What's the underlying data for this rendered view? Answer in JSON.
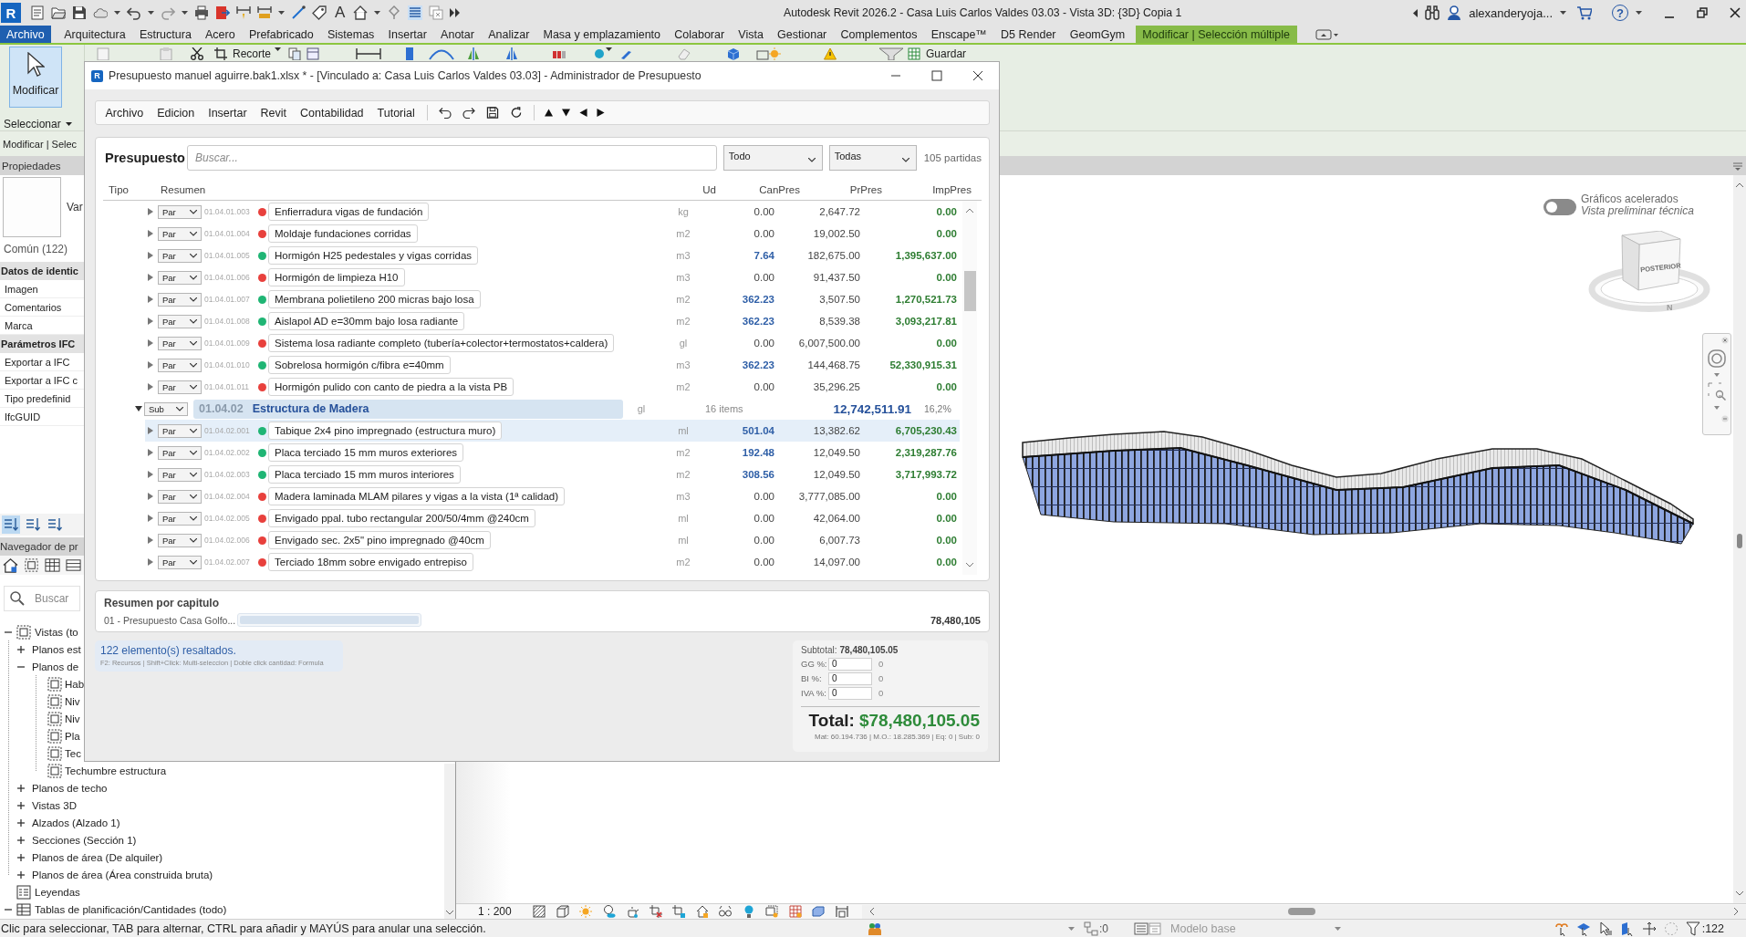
{
  "title_bar": {
    "logo_letter": "R",
    "text_tool_glyph": "A",
    "title": "Autodesk Revit 2026.2 - Casa Luis Carlos Valdes 03.03 - Vista 3D: {3D} Copia 1",
    "user": "alexanderyoja...",
    "help_glyph": "?"
  },
  "ribbon": {
    "tabs": [
      {
        "label": "Archivo",
        "kind": "file",
        "selected": false
      },
      {
        "label": "Arquitectura",
        "kind": "standard",
        "selected": false
      },
      {
        "label": "Estructura",
        "kind": "standard",
        "selected": false
      },
      {
        "label": "Acero",
        "kind": "standard",
        "selected": false
      },
      {
        "label": "Prefabricado",
        "kind": "standard",
        "selected": false
      },
      {
        "label": "Sistemas",
        "kind": "standard",
        "selected": false
      },
      {
        "label": "Insertar",
        "kind": "standard",
        "selected": false
      },
      {
        "label": "Anotar",
        "kind": "standard",
        "selected": false
      },
      {
        "label": "Analizar",
        "kind": "standard",
        "selected": false
      },
      {
        "label": "Masa y emplazamiento",
        "kind": "standard",
        "selected": false
      },
      {
        "label": "Colaborar",
        "kind": "standard",
        "selected": false
      },
      {
        "label": "Vista",
        "kind": "standard",
        "selected": false
      },
      {
        "label": "Gestionar",
        "kind": "standard",
        "selected": false
      },
      {
        "label": "Complementos",
        "kind": "standard",
        "selected": false
      },
      {
        "label": "Enscape™",
        "kind": "standard",
        "selected": false
      },
      {
        "label": "D5 Render",
        "kind": "standard",
        "selected": false
      },
      {
        "label": "GeomGym",
        "kind": "standard",
        "selected": false
      },
      {
        "label": "Modificar | Selección múltiple",
        "kind": "contextual",
        "selected": true
      }
    ],
    "modify_button": "Modificar",
    "select_menu": "Seleccionar",
    "crop_tool": "Recorte",
    "save_tool": "Guardar"
  },
  "options_bar": {
    "label": "Modificar | Selec"
  },
  "properties": {
    "title": "Propiedades",
    "type_name": "Var",
    "selection": "Común (122)",
    "groups": [
      {
        "name": "Datos de identic",
        "params": [
          "Imagen",
          "Comentarios",
          "Marca"
        ]
      },
      {
        "name": "Parámetros IFC",
        "params": [
          "Exportar a IFC",
          "Exportar a IFC c",
          "Tipo predefinid",
          "IfcGUID"
        ]
      }
    ]
  },
  "sort_buttons": [
    {
      "selected": true
    },
    {
      "selected": false
    },
    {
      "selected": false
    }
  ],
  "project_browser": {
    "title": "Navegador de pr",
    "search_placeholder": "Buscar",
    "tree": [
      {
        "label": "Vistas (to",
        "kind": "views",
        "expanded": true,
        "children": [
          {
            "label": "Planos est",
            "expanded": false
          },
          {
            "label": "Planos de",
            "expanded": true,
            "children": [
              {
                "label": "Hab"
              },
              {
                "label": "Niv"
              },
              {
                "label": "Niv"
              },
              {
                "label": "Pla"
              },
              {
                "label": "Tec"
              },
              {
                "label": "Techumbre estructura"
              }
            ]
          },
          {
            "label": "Planos de techo",
            "expanded": false
          },
          {
            "label": "Vistas 3D",
            "expanded": false
          },
          {
            "label": "Alzados (Alzado 1)",
            "expanded": false
          },
          {
            "label": "Secciones (Sección 1)",
            "expanded": false
          },
          {
            "label": "Planos de área (De alquiler)",
            "expanded": false
          },
          {
            "label": "Planos de área (Área construida bruta)",
            "expanded": false
          }
        ]
      },
      {
        "label": "Leyendas",
        "kind": "legends"
      },
      {
        "label": "Tablas de planificación/Cantidades (todo)",
        "kind": "schedules",
        "expanded": true
      }
    ]
  },
  "viewport": {
    "graphics_toggle": {
      "on": false,
      "title": "Gráficos acelerados",
      "subtitle": "Vista preliminar técnica"
    },
    "view_cube": {
      "face": "POSTERIOR",
      "compass": "N"
    }
  },
  "view_control_bar": {
    "scale": "1 : 200"
  },
  "status_bar": {
    "message": "Clic para seleccionar, TAB para alternar, CTRL para añadir y MAYÚS para anular una selección.",
    "workset_count": ":0",
    "design_option": "Modelo base",
    "selection_count": ":122"
  },
  "dialog": {
    "title": "Presupuesto manuel aguirre.bak1.xlsx * - [Vinculado a: Casa Luis Carlos Valdes 03.03] - Administrador de Presupuesto",
    "icon_letter": "R",
    "menu": [
      "Archivo",
      "Edicion",
      "Insertar",
      "Revit",
      "Contabilidad",
      "Tutorial"
    ],
    "heading": "Presupuesto",
    "search_placeholder": "Buscar...",
    "filters": [
      "Todo",
      "Todas"
    ],
    "count": "105 partidas",
    "columns": [
      "Tipo",
      "Resumen",
      "Ud",
      "CanPres",
      "PrPres",
      "ImpPres"
    ],
    "rows": [
      {
        "kind": "par",
        "type": "Par",
        "code": "01.04.01.003",
        "color": "#e8403c",
        "summary": "Enfierradura vigas de fundación",
        "unit": "kg",
        "quantity": "0.00",
        "price": "2,647.72",
        "amount": "0.00",
        "measured": false,
        "selected": false,
        "expanded": false
      },
      {
        "kind": "par",
        "type": "Par",
        "code": "01.04.01.004",
        "color": "#e8403c",
        "summary": "Moldaje fundaciones corridas",
        "unit": "m2",
        "quantity": "0.00",
        "price": "19,002.50",
        "amount": "0.00",
        "measured": false,
        "selected": false,
        "expanded": false
      },
      {
        "kind": "par",
        "type": "Par",
        "code": "01.04.01.005",
        "color": "#1fb574",
        "summary": "Hormigón H25 pedestales y vigas corridas",
        "unit": "m3",
        "quantity": "7.64",
        "price": "182,675.00",
        "amount": "1,395,637.00",
        "measured": true,
        "selected": false,
        "expanded": false
      },
      {
        "kind": "par",
        "type": "Par",
        "code": "01.04.01.006",
        "color": "#e8403c",
        "summary": "Hormigón de limpieza H10",
        "unit": "m3",
        "quantity": "0.00",
        "price": "91,437.50",
        "amount": "0.00",
        "measured": false,
        "selected": false,
        "expanded": false
      },
      {
        "kind": "par",
        "type": "Par",
        "code": "01.04.01.007",
        "color": "#1fb574",
        "summary": "Membrana polietileno 200 micras bajo losa",
        "unit": "m2",
        "quantity": "362.23",
        "price": "3,507.50",
        "amount": "1,270,521.73",
        "measured": true,
        "selected": false,
        "expanded": false
      },
      {
        "kind": "par",
        "type": "Par",
        "code": "01.04.01.008",
        "color": "#1fb574",
        "summary": "Aislapol AD e=30mm bajo losa radiante",
        "unit": "m2",
        "quantity": "362.23",
        "price": "8,539.38",
        "amount": "3,093,217.81",
        "measured": true,
        "selected": false,
        "expanded": false
      },
      {
        "kind": "par",
        "type": "Par",
        "code": "01.04.01.009",
        "color": "#e8403c",
        "summary": "Sistema losa radiante completo (tubería+colector+termostatos+caldera)",
        "unit": "gl",
        "quantity": "0.00",
        "price": "6,007,500.00",
        "amount": "0.00",
        "measured": false,
        "selected": false,
        "expanded": false
      },
      {
        "kind": "par",
        "type": "Par",
        "code": "01.04.01.010",
        "color": "#1fb574",
        "summary": "Sobrelosa hormigón c/fibra e=40mm",
        "unit": "m3",
        "quantity": "362.23",
        "price": "144,468.75",
        "amount": "52,330,915.31",
        "measured": true,
        "selected": false,
        "expanded": false
      },
      {
        "kind": "par",
        "type": "Par",
        "code": "01.04.01.011",
        "color": "#e8403c",
        "summary": "Hormigón pulido con canto de piedra a la vista PB",
        "unit": "m2",
        "quantity": "0.00",
        "price": "35,296.25",
        "amount": "0.00",
        "measured": false,
        "selected": false,
        "expanded": false
      },
      {
        "kind": "sub",
        "type": "Sub",
        "code": "01.04.02",
        "summary": "Estructura de Madera",
        "unit": "gl",
        "items": "16 items",
        "amount": "12,742,511.91",
        "share": "16,2%",
        "selected": false,
        "expanded": true,
        "children": [
          {
            "kind": "par",
            "type": "Par",
            "code": "01.04.02.001",
            "color": "#1fb574",
            "summary": "Tabique 2x4 pino impregnado (estructura muro)",
            "unit": "ml",
            "quantity": "501.04",
            "price": "13,382.62",
            "amount": "6,705,230.43",
            "measured": true,
            "selected": true,
            "expanded": false
          },
          {
            "kind": "par",
            "type": "Par",
            "code": "01.04.02.002",
            "color": "#1fb574",
            "summary": "Placa terciado 15 mm muros exteriores",
            "unit": "m2",
            "quantity": "192.48",
            "price": "12,049.50",
            "amount": "2,319,287.76",
            "measured": true,
            "selected": false,
            "expanded": false
          },
          {
            "kind": "par",
            "type": "Par",
            "code": "01.04.02.003",
            "color": "#1fb574",
            "summary": "Placa terciado 15 mm muros interiores",
            "unit": "m2",
            "quantity": "308.56",
            "price": "12,049.50",
            "amount": "3,717,993.72",
            "measured": true,
            "selected": false,
            "expanded": false
          },
          {
            "kind": "par",
            "type": "Par",
            "code": "01.04.02.004",
            "color": "#e8403c",
            "summary": "Madera laminada MLAM pilares y vigas a la vista (1ª calidad)",
            "unit": "m3",
            "quantity": "0.00",
            "price": "3,777,085.00",
            "amount": "0.00",
            "measured": false,
            "selected": false,
            "expanded": false
          },
          {
            "kind": "par",
            "type": "Par",
            "code": "01.04.02.005",
            "color": "#e8403c",
            "summary": "Envigado ppal. tubo rectangular 200/50/4mm @240cm",
            "unit": "ml",
            "quantity": "0.00",
            "price": "42,064.00",
            "amount": "0.00",
            "measured": false,
            "selected": false,
            "expanded": false
          },
          {
            "kind": "par",
            "type": "Par",
            "code": "01.04.02.006",
            "color": "#e8403c",
            "summary": "Envigado sec. 2x5\" pino impregnado @40cm",
            "unit": "ml",
            "quantity": "0.00",
            "price": "6,007.73",
            "amount": "0.00",
            "measured": false,
            "selected": false,
            "expanded": false
          },
          {
            "kind": "par",
            "type": "Par",
            "code": "01.04.02.007",
            "color": "#e8403c",
            "summary": "Terciado 18mm sobre envigado entrepiso",
            "unit": "m2",
            "quantity": "0.00",
            "price": "14,097.00",
            "amount": "0.00",
            "measured": false,
            "selected": false,
            "expanded": false
          }
        ]
      }
    ],
    "chapter_summary": {
      "title": "Resumen por capitulo",
      "chapters": [
        {
          "name": "01 - Presupuesto Casa Golfo...",
          "level": 1,
          "amount": "78,480,105"
        }
      ]
    },
    "info": {
      "message": "122 elemento(s) resaltados.",
      "hint": "F2: Recursos | Shift+Click: Multi-seleccion | Doble click cantidad: Formula"
    },
    "totals": {
      "subtotal_label": "Subtotal:",
      "subtotal": "78,480,105.05",
      "rates": [
        {
          "label": "GG %:",
          "value": "0",
          "result": "0"
        },
        {
          "label": "BI %:",
          "value": "0",
          "result": "0"
        },
        {
          "label": "IVA %:",
          "value": "0",
          "result": "0"
        }
      ],
      "total_label": "Total:",
      "total": "$78,480,105.05",
      "breakdown": "Mat: 60.194.736 | M.O.: 18.285.369 | Eq: 0 | Sub: 0"
    }
  }
}
